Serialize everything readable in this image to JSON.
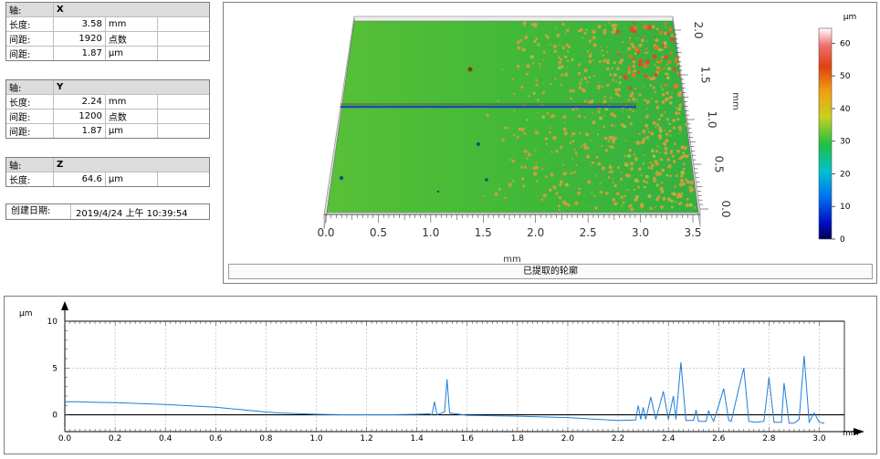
{
  "axis_x": {
    "k1": "轴:",
    "v1": "X",
    "k2": "长度:",
    "v2": "3.58",
    "u2": "mm",
    "k3": "间距:",
    "v3": "1920",
    "u3": "点数",
    "k4": "间距:",
    "v4": "1.87",
    "u4": "μm"
  },
  "axis_y": {
    "k1": "轴:",
    "v1": "Y",
    "k2": "长度:",
    "v2": "2.24",
    "u2": "mm",
    "k3": "间距:",
    "v3": "1200",
    "u3": "点数",
    "k4": "间距:",
    "v4": "1.87",
    "u4": "μm"
  },
  "axis_z": {
    "k1": "轴:",
    "v1": "Z",
    "k2": "长度:",
    "v2": "64.6",
    "u2": "μm"
  },
  "created": {
    "label": "创建日期:",
    "value": "2019/4/24 上午 10:39:54"
  },
  "profile_label": "已提取的轮廓",
  "surface": {
    "x_unit": "mm",
    "y_unit": "mm",
    "x_ticks": [
      "0.0",
      "0.5",
      "1.0",
      "1.5",
      "2.0",
      "2.5",
      "3.0",
      "3.5"
    ],
    "y_ticks": [
      "0.0",
      "0.5",
      "1.0",
      "1.5",
      "2.0"
    ],
    "colors": {
      "base": "#3cb43c",
      "rough": "#c8a03c",
      "peak": "#d8502a",
      "line": "#1a4ab0"
    }
  },
  "colorbar": {
    "unit": "μm",
    "ticks": [
      "0",
      "10",
      "20",
      "30",
      "40",
      "50",
      "60"
    ],
    "range": [
      0,
      64.6
    ]
  },
  "chart_data": {
    "type": "line",
    "xlabel": "mm",
    "ylabel": "μm",
    "xlim": [
      0,
      3.1
    ],
    "ylim": [
      -1.8,
      10
    ],
    "x_ticks": [
      "0.0",
      "0.2",
      "0.4",
      "0.6",
      "0.8",
      "1.0",
      "1.2",
      "1.4",
      "1.6",
      "1.8",
      "2.0",
      "2.2",
      "2.4",
      "2.6",
      "2.8",
      "3.0"
    ],
    "y_ticks": [
      "0",
      "5",
      "10"
    ],
    "grid": true,
    "series": [
      {
        "color": "#1e7ed6",
        "points": [
          [
            0,
            1.4
          ],
          [
            0.05,
            1.4
          ],
          [
            0.1,
            1.35
          ],
          [
            0.2,
            1.3
          ],
          [
            0.3,
            1.2
          ],
          [
            0.4,
            1.1
          ],
          [
            0.5,
            0.95
          ],
          [
            0.6,
            0.8
          ],
          [
            0.7,
            0.55
          ],
          [
            0.8,
            0.3
          ],
          [
            0.85,
            0.2
          ],
          [
            0.9,
            0.15
          ],
          [
            1.0,
            0.05
          ],
          [
            1.1,
            0.0
          ],
          [
            1.2,
            0.0
          ],
          [
            1.3,
            0.0
          ],
          [
            1.4,
            0.05
          ],
          [
            1.45,
            0.1
          ],
          [
            1.46,
            0.0
          ],
          [
            1.47,
            1.4
          ],
          [
            1.48,
            0.0
          ],
          [
            1.5,
            0.2
          ],
          [
            1.51,
            0.3
          ],
          [
            1.52,
            3.8
          ],
          [
            1.53,
            0.2
          ],
          [
            1.6,
            -0.05
          ],
          [
            1.8,
            -0.15
          ],
          [
            2.0,
            -0.3
          ],
          [
            2.1,
            -0.45
          ],
          [
            2.2,
            -0.6
          ],
          [
            2.27,
            -0.55
          ],
          [
            2.28,
            1.0
          ],
          [
            2.29,
            -0.5
          ],
          [
            2.3,
            0.8
          ],
          [
            2.31,
            -0.5
          ],
          [
            2.33,
            1.9
          ],
          [
            2.35,
            -0.5
          ],
          [
            2.38,
            2.5
          ],
          [
            2.4,
            -0.5
          ],
          [
            2.42,
            2.0
          ],
          [
            2.43,
            -0.5
          ],
          [
            2.45,
            5.6
          ],
          [
            2.47,
            -0.6
          ],
          [
            2.5,
            -0.6
          ],
          [
            2.51,
            0.5
          ],
          [
            2.52,
            -0.7
          ],
          [
            2.55,
            -0.7
          ],
          [
            2.56,
            0.4
          ],
          [
            2.58,
            -0.7
          ],
          [
            2.6,
            1.0
          ],
          [
            2.62,
            2.8
          ],
          [
            2.64,
            -0.6
          ],
          [
            2.65,
            -0.7
          ],
          [
            2.68,
            2.8
          ],
          [
            2.7,
            5.0
          ],
          [
            2.72,
            -0.7
          ],
          [
            2.75,
            -0.8
          ],
          [
            2.78,
            -0.7
          ],
          [
            2.8,
            4.0
          ],
          [
            2.82,
            -0.8
          ],
          [
            2.85,
            -0.8
          ],
          [
            2.86,
            3.4
          ],
          [
            2.88,
            -0.9
          ],
          [
            2.9,
            -0.9
          ],
          [
            2.92,
            -0.5
          ],
          [
            2.94,
            6.3
          ],
          [
            2.96,
            -0.8
          ],
          [
            2.98,
            0.2
          ],
          [
            3.0,
            -0.8
          ],
          [
            3.02,
            -0.9
          ]
        ]
      }
    ]
  }
}
